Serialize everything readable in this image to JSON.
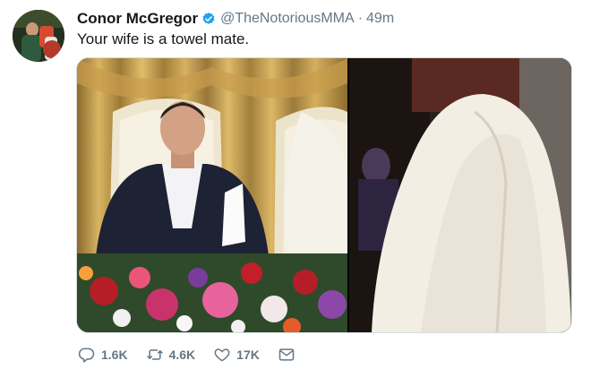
{
  "tweet": {
    "author_name": "Conor McGregor",
    "handle": "@TheNotoriousMMA",
    "separator": "·",
    "time": "49m",
    "text": "Your wife is a towel mate.",
    "verified": true
  },
  "actions": {
    "replies": "1.6K",
    "retweets": "4.6K",
    "likes": "17K"
  },
  "colors": {
    "text": "#14171a",
    "secondary": "#657786",
    "verified_badge": "#1da1f2"
  },
  "icons": [
    "reply-icon",
    "retweet-icon",
    "like-icon",
    "dm-icon",
    "verified-icon"
  ]
}
